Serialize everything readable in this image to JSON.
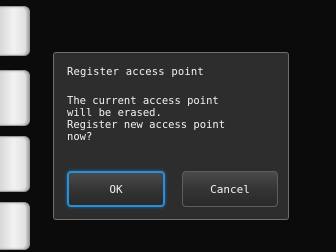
{
  "dialog": {
    "title": "Register access point",
    "message": "The current access point\nwill be erased.\nRegister new access point\nnow?",
    "ok_label": "OK",
    "cancel_label": "Cancel"
  },
  "colors": {
    "background": "#0b0b0b",
    "dialog_background": "#2d2d2d",
    "focus_border": "#2a8fd6"
  }
}
